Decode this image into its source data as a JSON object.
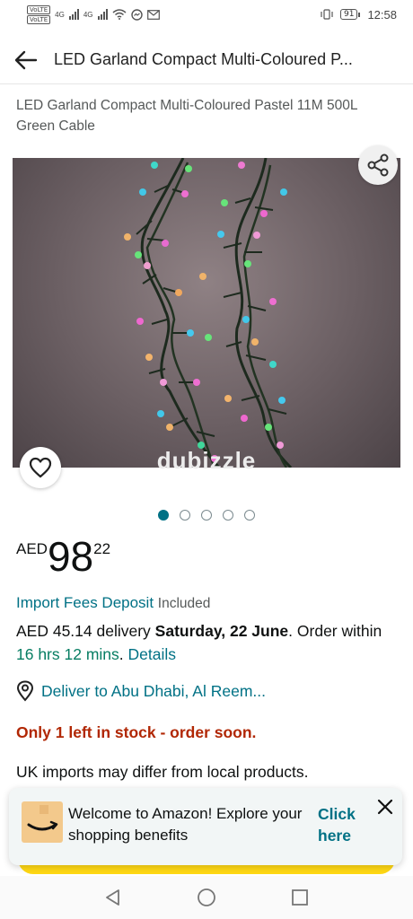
{
  "status_bar": {
    "sim1_label": "VoLTE",
    "sim2_label": "VoLTE",
    "net1": "4G",
    "net2": "4G",
    "battery": "91",
    "time": "12:58"
  },
  "header": {
    "title": "LED Garland Compact Multi-Coloured P...",
    "back_icon": "arrow-left-icon"
  },
  "product": {
    "title": "LED Garland Compact Multi-Coloured Pastel 11M 500L Green Cable",
    "watermark": "dubizzle",
    "image_count": 5,
    "active_image": 1
  },
  "price": {
    "currency": "AED",
    "whole": "98",
    "fraction": "22"
  },
  "import_fees": {
    "link": "Import Fees Deposit",
    "status": "Included"
  },
  "delivery": {
    "cost": "AED 45.14 delivery ",
    "date": "Saturday, 22 June",
    "order_prefix": ". Order within ",
    "countdown": "16 hrs 12 mins",
    "sep": ". ",
    "details_link": "Details"
  },
  "deliver_to": {
    "text": "Deliver to Abu Dhabi, Al Reem..."
  },
  "stock": {
    "text": "Only 1 left in stock - order soon."
  },
  "note": {
    "text": "UK imports may differ from local products."
  },
  "toast": {
    "message": "Welcome to Amazon! Explore your shopping benefits",
    "cta": "Click here"
  },
  "colors": {
    "link": "#007185",
    "price_green": "#067d62",
    "stock_red": "#b12704",
    "cta_yellow": "#ffd814",
    "accent_dot": "#007185"
  }
}
